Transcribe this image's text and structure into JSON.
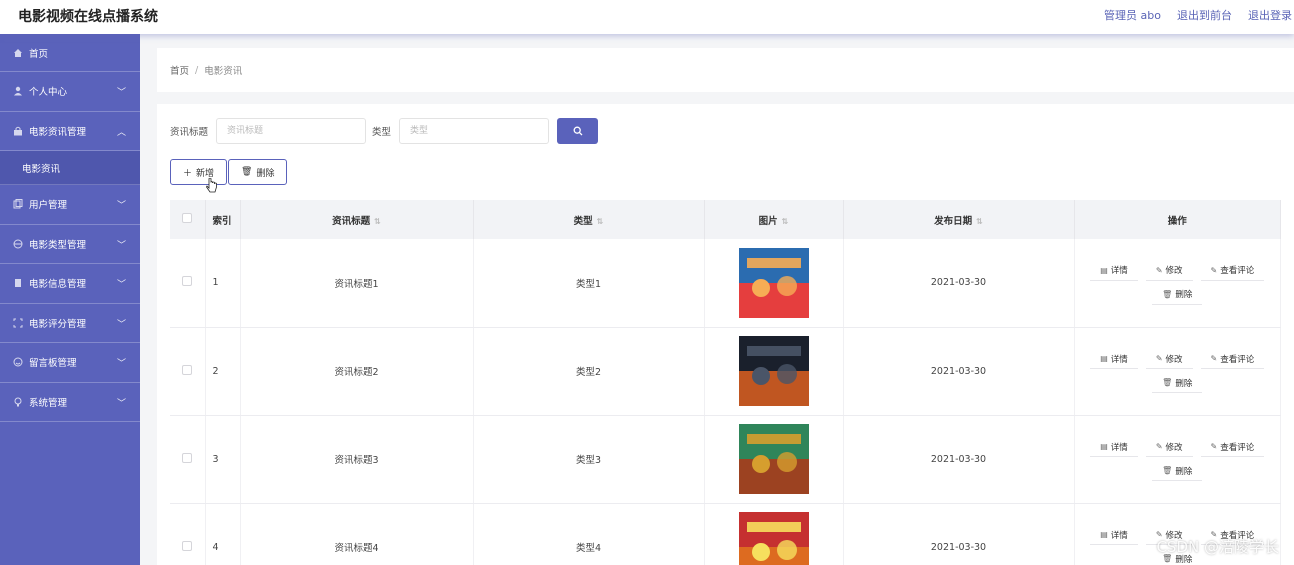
{
  "header": {
    "title": "电影视频在线点播系统",
    "admin_label": "管理员 abo",
    "exit_front": "退出到前台",
    "logout": "退出登录"
  },
  "sidebar": {
    "items": [
      {
        "label": "首页",
        "icon": "home-icon"
      },
      {
        "label": "个人中心",
        "icon": "user-icon"
      },
      {
        "label": "电影资讯管理",
        "icon": "lock-icon"
      },
      {
        "label": "电影资讯",
        "icon": ""
      },
      {
        "label": "用户管理",
        "icon": "copy-icon"
      },
      {
        "label": "电影类型管理",
        "icon": "globe-icon"
      },
      {
        "label": "电影信息管理",
        "icon": "document-icon"
      },
      {
        "label": "电影评分管理",
        "icon": "frame-icon"
      },
      {
        "label": "留言板管理",
        "icon": "smile-icon"
      },
      {
        "label": "系统管理",
        "icon": "bulb-icon"
      }
    ]
  },
  "breadcrumb": {
    "home": "首页",
    "separator": "/",
    "current": "电影资讯"
  },
  "search": {
    "title_label": "资讯标题",
    "title_placeholder": "资讯标题",
    "type_label": "类型",
    "type_placeholder": "类型"
  },
  "actions": {
    "add": "新增",
    "delete": "删除"
  },
  "table": {
    "headers": {
      "index": "索引",
      "title": "资讯标题",
      "type": "类型",
      "image": "图片",
      "date": "发布日期",
      "ops": "操作"
    },
    "rows": [
      {
        "index": "1",
        "title": "资讯标题1",
        "type": "类型1",
        "date": "2021-03-30"
      },
      {
        "index": "2",
        "title": "资讯标题2",
        "type": "类型2",
        "date": "2021-03-30"
      },
      {
        "index": "3",
        "title": "资讯标题3",
        "type": "类型3",
        "date": "2021-03-30"
      },
      {
        "index": "4",
        "title": "资讯标题4",
        "type": "类型4",
        "date": "2021-03-30"
      }
    ],
    "op_labels": {
      "detail": "详情",
      "edit": "修改",
      "comments": "查看评论",
      "delete": "删除"
    }
  },
  "watermark": "CSDN @涪陵学长",
  "colors": {
    "accent": "#5a62bb",
    "sidebar_bg": "#5a62bb",
    "submenu_bg": "#4f57ad"
  }
}
